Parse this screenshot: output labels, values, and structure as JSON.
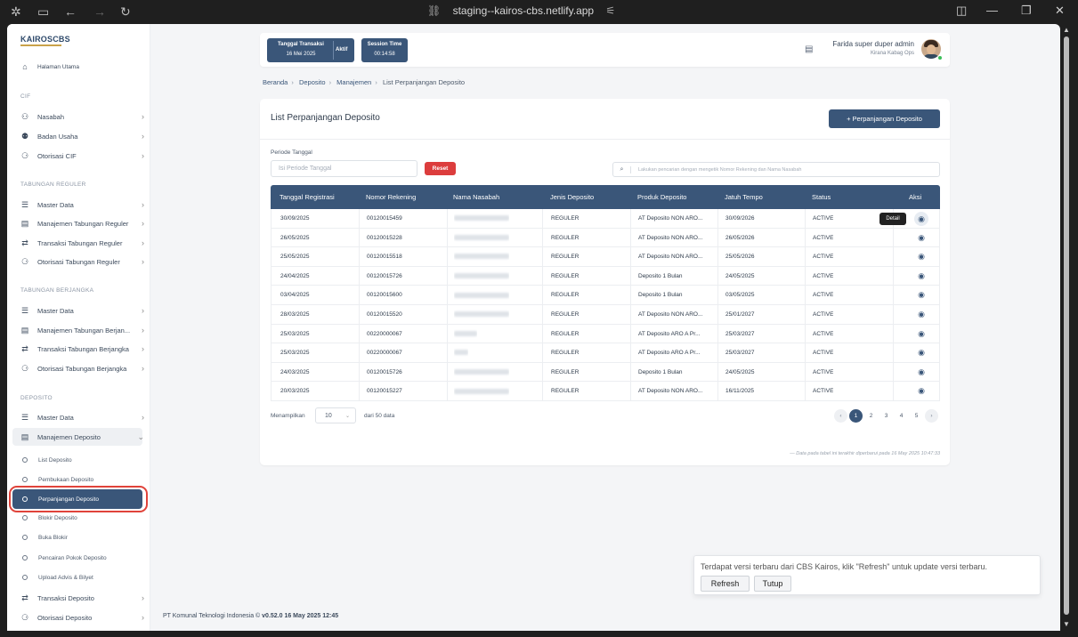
{
  "browser": {
    "url": "staging--kairos-cbs.netlify.app"
  },
  "brand": {
    "logo": "KAIROSCBS"
  },
  "sidebar": {
    "home": "Halaman Utama",
    "sections": {
      "cif": "CIF",
      "tabungan_reguler": "TABUNGAN REGULER",
      "tabungan_berjangka": "TABUNGAN BERJANGKA",
      "deposito": "DEPOSITO"
    },
    "cif_items": [
      "Nasabah",
      "Badan Usaha",
      "Otorisasi CIF"
    ],
    "reguler_items": [
      "Master Data",
      "Manajemen Tabungan Reguler",
      "Transaksi Tabungan Reguler",
      "Otorisasi Tabungan Reguler"
    ],
    "berjangka_items": [
      "Master Data",
      "Manajemen Tabungan Berjan...",
      "Transaksi Tabungan Berjangka",
      "Otorisasi Tabungan Berjangka"
    ],
    "deposito_items": [
      "Master Data",
      "Manajemen Deposito"
    ],
    "deposito_sub": [
      "List Deposito",
      "Pembukaan Deposito",
      "Perpanjangan Deposito",
      "Blokir Deposito",
      "Buka Blokir",
      "Pencairan Pokok Deposito",
      "Upload Advis & Bilyet"
    ],
    "deposito_bottom": [
      "Transaksi Deposito",
      "Otorisasi Deposito"
    ]
  },
  "header": {
    "tx_label": "Tanggal Transaksi",
    "tx_date": "16 Mei 2025",
    "tx_status": "Aktif",
    "session_label": "Session Time",
    "session_time": "00:14:58",
    "user_name": "Farida super duper admin",
    "user_role": "Kirana Kabag Ops"
  },
  "breadcrumb": [
    "Beranda",
    "Deposito",
    "Manajemen",
    "List Perpanjangan Deposito"
  ],
  "card": {
    "title": "List Perpanjangan Deposito",
    "add_button": "+ Perpanjangan Deposito",
    "period_label": "Periode Tanggal",
    "period_placeholder": "Isi Periode Tanggal",
    "reset": "Reset",
    "search_placeholder": "Lakukan pencarian dengan mengetik Nomor Rekening dan Nama Nasabah"
  },
  "table": {
    "columns": [
      "Tanggal Registrasi",
      "Nomor Rekening",
      "Nama Nasabah",
      "Jenis Deposito",
      "Produk Deposito",
      "Jatuh Tempo",
      "Status",
      "Aksi"
    ],
    "tooltip": "Detail",
    "rows": [
      {
        "tgl": "30/09/2025",
        "rek": "00120015459",
        "jenis": "REGULER",
        "produk": "AT Deposito NON ARO...",
        "tempo": "30/09/2026",
        "status": "ACTIVE"
      },
      {
        "tgl": "26/05/2025",
        "rek": "00120015228",
        "jenis": "REGULER",
        "produk": "AT Deposito NON ARO...",
        "tempo": "26/05/2026",
        "status": "ACTIVE"
      },
      {
        "tgl": "25/05/2025",
        "rek": "00120015518",
        "jenis": "REGULER",
        "produk": "AT Deposito NON ARO...",
        "tempo": "25/05/2026",
        "status": "ACTIVE"
      },
      {
        "tgl": "24/04/2025",
        "rek": "00120015726",
        "jenis": "REGULER",
        "produk": "Deposito 1 Bulan",
        "tempo": "24/05/2025",
        "status": "ACTIVE"
      },
      {
        "tgl": "03/04/2025",
        "rek": "00120015600",
        "jenis": "REGULER",
        "produk": "Deposito 1 Bulan",
        "tempo": "03/05/2025",
        "status": "ACTIVE"
      },
      {
        "tgl": "28/03/2025",
        "rek": "00120015520",
        "jenis": "REGULER",
        "produk": "AT Deposito NON ARO...",
        "tempo": "25/01/2027",
        "status": "ACTIVE"
      },
      {
        "tgl": "25/03/2025",
        "rek": "00220000067",
        "jenis": "REGULER",
        "produk": "AT Deposito ARO A Pr...",
        "tempo": "25/03/2027",
        "status": "ACTIVE"
      },
      {
        "tgl": "25/03/2025",
        "rek": "00220000067",
        "jenis": "REGULER",
        "produk": "AT Deposito ARO A Pr...",
        "tempo": "25/03/2027",
        "status": "ACTIVE"
      },
      {
        "tgl": "24/03/2025",
        "rek": "00120015726",
        "jenis": "REGULER",
        "produk": "Deposito 1 Bulan",
        "tempo": "24/05/2025",
        "status": "ACTIVE"
      },
      {
        "tgl": "20/03/2025",
        "rek": "00120015227",
        "jenis": "REGULER",
        "produk": "AT Deposito NON ARO...",
        "tempo": "16/11/2025",
        "status": "ACTIVE"
      }
    ]
  },
  "pagination": {
    "show_label": "Menampilkan",
    "page_size": "10",
    "from_label": "dari 50 data",
    "pages": [
      "1",
      "2",
      "3",
      "4",
      "5"
    ],
    "prev": "‹",
    "next": "›"
  },
  "updated_note": "— Data pada tabel ini terakhir diperbarui pada 16 May 2025 10:47:33",
  "footer": {
    "company": "PT Komunal Teknologi Indonesia ©",
    "version": "v0.52.0 16 May 2025 12:45"
  },
  "toast": {
    "message": "Terdapat versi terbaru dari CBS Kairos, klik \"Refresh\" untuk update versi terbaru.",
    "refresh": "Refresh",
    "close": "Tutup"
  },
  "colors": {
    "primary": "#3a5679",
    "danger": "#dc3d3d",
    "highlight": "#e0433a"
  }
}
